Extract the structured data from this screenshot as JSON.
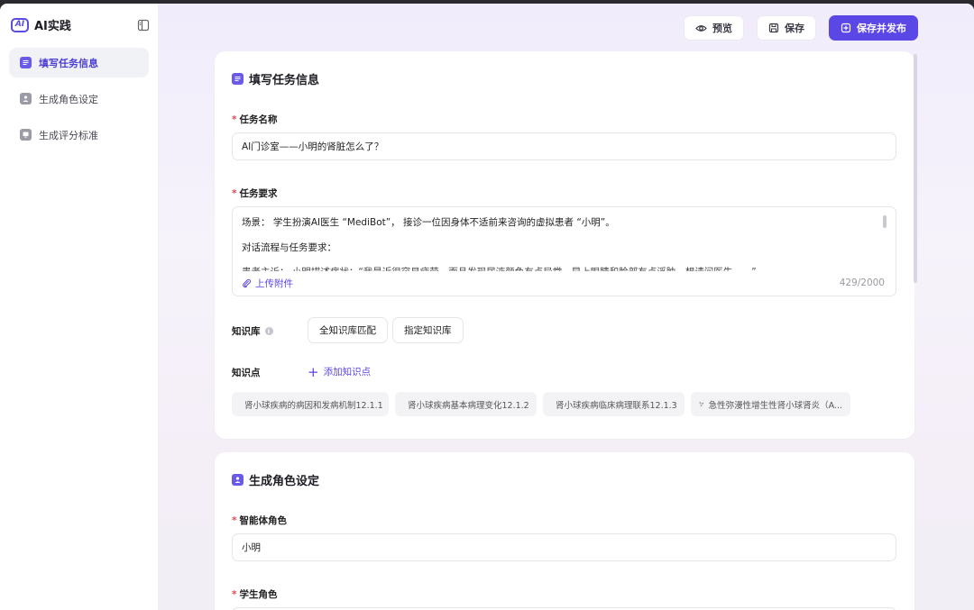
{
  "app": {
    "name": "AI实践"
  },
  "sidebar": {
    "items": [
      {
        "label": "填写任务信息",
        "active": true
      },
      {
        "label": "生成角色设定",
        "active": false
      },
      {
        "label": "生成评分标准",
        "active": false
      }
    ]
  },
  "toolbar": {
    "preview_label": "预览",
    "save_label": "保存",
    "publish_label": "保存并发布"
  },
  "task_card": {
    "title": "填写任务信息",
    "task_name": {
      "label": "任务名称",
      "value": "AI门诊室——小明的肾脏怎么了？"
    },
    "task_requirement": {
      "label": "任务要求",
      "line1": "场景： 学生扮演AI医生 “MediBot”， 接诊一位因身体不适前来咨询的虚拟患者 “小明”。",
      "line2": "对话流程与任务要求：",
      "line3": "患者主诉： 小明描述症状：“我最近很容易疲劳，而且发现尿液颜色有点异常，早上眼睛和脸部有点浮肿，想请问医生……”",
      "upload_label": "上传附件",
      "counter": "429/2000"
    },
    "knowledge_base": {
      "label": "知识库",
      "options": [
        "全知识库匹配",
        "指定知识库"
      ]
    },
    "knowledge_points": {
      "label": "知识点",
      "add_label": "添加知识点",
      "items": [
        "肾小球疾病的病因和发病机制12.1.1",
        "肾小球疾病基本病理变化12.1.2",
        "肾小球疾病临床病理联系12.1.3",
        "急性弥漫性增生性肾小球肾炎（A..."
      ]
    }
  },
  "role_card": {
    "title": "生成角色设定",
    "agent_role": {
      "label": "智能体角色",
      "value": "小明"
    },
    "student_role": {
      "label": "学生角色"
    }
  },
  "colors": {
    "accent": "#5b46e6",
    "required": "#e5484d"
  }
}
